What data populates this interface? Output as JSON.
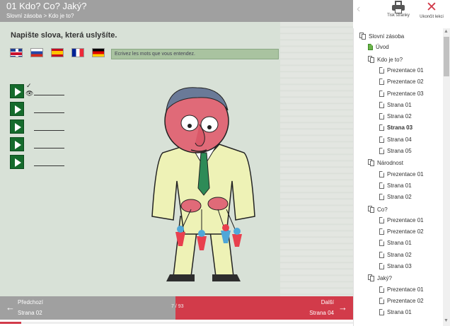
{
  "header": {
    "title": "01 Kdo? Co? Jaký?",
    "breadcrumb": "Slovní zásoba > Kdo je to?"
  },
  "content": {
    "instruction": "Napište slova, která uslyšíte.",
    "flags": [
      "uk-flag",
      "ru-flag",
      "es-flag",
      "fr-flag",
      "de-flag"
    ],
    "translation": "Ecrivez les mots que vous entendez.",
    "rows": [
      {
        "marks": [
          "✓",
          "👁"
        ]
      },
      {
        "marks": []
      },
      {
        "marks": []
      },
      {
        "marks": []
      },
      {
        "marks": []
      }
    ]
  },
  "footer": {
    "prev_label": "Předchozí",
    "prev_page": "Strana 02",
    "next_label": "Další",
    "next_page": "Strana 04",
    "page_count": "7 / 93",
    "progress": 0.06
  },
  "toolbar": {
    "print_label": "Tisk stránky",
    "close_label": "Ukončit lekci"
  },
  "tree": {
    "items": [
      {
        "label": "Slovní zásoba",
        "level": 0,
        "type": "folder"
      },
      {
        "label": "Úvod",
        "level": 1,
        "type": "page-green"
      },
      {
        "label": "Kdo je to?",
        "level": 1,
        "type": "folder"
      },
      {
        "label": "Prezentace 01",
        "level": 2,
        "type": "page"
      },
      {
        "label": "Prezentace 02",
        "level": 2,
        "type": "page"
      },
      {
        "label": "Prezentace 03",
        "level": 2,
        "type": "page"
      },
      {
        "label": "Strana 01",
        "level": 2,
        "type": "page"
      },
      {
        "label": "Strana 02",
        "level": 2,
        "type": "page"
      },
      {
        "label": "Strana 03",
        "level": 2,
        "type": "page",
        "active": true
      },
      {
        "label": "Strana 04",
        "level": 2,
        "type": "page"
      },
      {
        "label": "Strana 05",
        "level": 2,
        "type": "page"
      },
      {
        "label": "Národnost",
        "level": 1,
        "type": "folder"
      },
      {
        "label": "Prezentace 01",
        "level": 2,
        "type": "page"
      },
      {
        "label": "Strana 01",
        "level": 2,
        "type": "page"
      },
      {
        "label": "Strana 02",
        "level": 2,
        "type": "page"
      },
      {
        "label": "Co?",
        "level": 1,
        "type": "folder"
      },
      {
        "label": "Prezentace 01",
        "level": 2,
        "type": "page"
      },
      {
        "label": "Prezentace 02",
        "level": 2,
        "type": "page"
      },
      {
        "label": "Strana 01",
        "level": 2,
        "type": "page"
      },
      {
        "label": "Strana 02",
        "level": 2,
        "type": "page"
      },
      {
        "label": "Strana 03",
        "level": 2,
        "type": "page"
      },
      {
        "label": "Jaký?",
        "level": 1,
        "type": "folder"
      },
      {
        "label": "Prezentace 01",
        "level": 2,
        "type": "page"
      },
      {
        "label": "Prezentace 02",
        "level": 2,
        "type": "page"
      },
      {
        "label": "Strana 01",
        "level": 2,
        "type": "page"
      }
    ]
  }
}
